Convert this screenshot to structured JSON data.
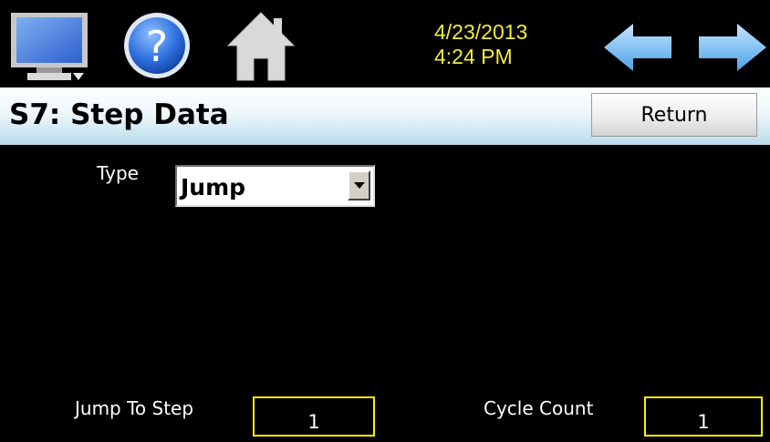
{
  "header": {
    "date": "4/23/2013",
    "time": "4:24 PM",
    "icons": [
      "monitor-menu-icon",
      "help-icon",
      "home-icon",
      "back-arrow-icon",
      "forward-arrow-icon"
    ]
  },
  "title_bar": {
    "title": "S7: Step Data",
    "return_label": "Return"
  },
  "form": {
    "type_label": "Type",
    "type_value": "Jump",
    "jump_to_step_label": "Jump To Step",
    "jump_to_step_value": "1",
    "cycle_count_label": "Cycle Count",
    "cycle_count_value": "1"
  },
  "colors": {
    "background": "#000000",
    "datetime": "#f2ec3a",
    "field_border": "#ffee00",
    "title_gradient_bottom": "#b9dbec",
    "arrow_blue": "#4aa3e6"
  }
}
